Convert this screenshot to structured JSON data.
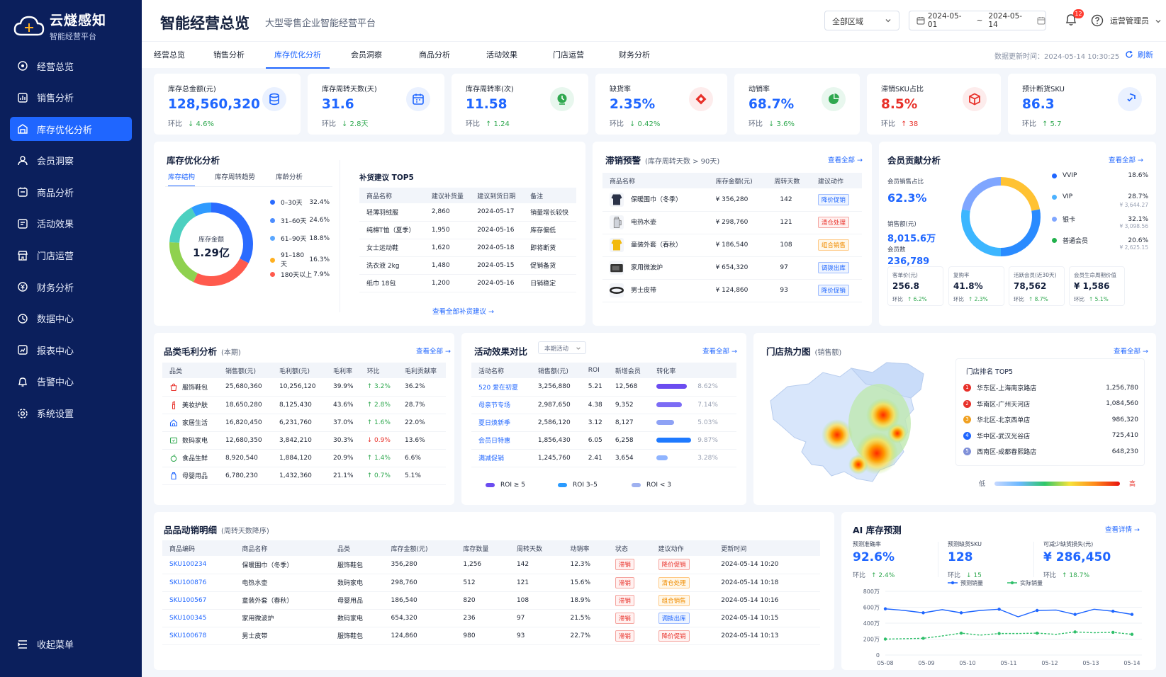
{
  "brand": {
    "name": "云燧感知",
    "tagline": "智能经营平台"
  },
  "sidebar": {
    "items": [
      {
        "label": "经营总览",
        "icon": "overview-icon"
      },
      {
        "label": "销售分析",
        "icon": "sales-icon"
      },
      {
        "label": "库存优化分析",
        "icon": "inventory-icon",
        "active": true
      },
      {
        "label": "会员洞察",
        "icon": "member-icon"
      },
      {
        "label": "商品分析",
        "icon": "product-icon"
      },
      {
        "label": "活动效果",
        "icon": "campaign-icon"
      },
      {
        "label": "门店运营",
        "icon": "store-icon"
      },
      {
        "label": "财务分析",
        "icon": "finance-icon"
      },
      {
        "label": "数据中心",
        "icon": "data-icon"
      },
      {
        "label": "报表中心",
        "icon": "report-icon"
      },
      {
        "label": "告警中心",
        "icon": "alarm-icon"
      },
      {
        "label": "系统设置",
        "icon": "settings-icon"
      }
    ],
    "collapse_label": "收起菜单"
  },
  "header": {
    "title": "智能经营总览",
    "subtitle": "大型零售企业智能经营平台",
    "region": "全部区域",
    "date_start": "2024-05-01",
    "date_sep": "~",
    "date_end": "2024-05-14",
    "notif_count": "12",
    "user": "运营管理员"
  },
  "tabs": {
    "items": [
      "经营总览",
      "销售分析",
      "库存优化分析",
      "会员洞察",
      "商品分析",
      "活动效果",
      "门店运营",
      "财务分析"
    ],
    "active_index": 2,
    "update_time": "数据更新时间：2024-05-14 10:30:25",
    "refresh": "刷新"
  },
  "kpis": [
    {
      "label": "库存总金额(元)",
      "value": "128,560,320",
      "cmp": "环比",
      "delta": "↓ 4.6%",
      "accent": "#1f66ff",
      "bg": "#eaf1ff",
      "icon": "database-icon"
    },
    {
      "label": "库存周转天数(天)",
      "value": "31.6",
      "cmp": "环比",
      "delta": "↓ 2.8天",
      "accent": "#1f66ff",
      "bg": "#eaf1ff",
      "icon": "calendar-icon"
    },
    {
      "label": "库存周转率(次)",
      "value": "11.58",
      "cmp": "环比",
      "delta": "↑ 1.24",
      "accent": "#2fa84f",
      "bg": "#e8f7ee",
      "icon": "turnover-icon"
    },
    {
      "label": "缺货率",
      "value": "2.35%",
      "cmp": "环比",
      "delta": "↓ 0.42%",
      "accent": "#e8312a",
      "bg": "#fdecec",
      "icon": "diamond-icon"
    },
    {
      "label": "动销率",
      "value": "68.7%",
      "cmp": "环比",
      "delta": "↓ 3.6%",
      "accent": "#2fa84f",
      "bg": "#e8f7ee",
      "icon": "pie-icon"
    },
    {
      "label": "滞销SKU占比",
      "value": "8.5%",
      "cmp": "环比",
      "delta": "↑ 38",
      "accent": "#e8312a",
      "bg": "#fdecec",
      "icon": "cube-icon",
      "red": true
    },
    {
      "label": "预计断货SKU",
      "value": "86.3",
      "cmp": "环比",
      "delta": "↑ 5.7",
      "accent": "#1f66ff",
      "bg": "#eaf1ff",
      "icon": "shield-icon"
    }
  ],
  "inventory": {
    "title": "库存优化分析",
    "subtabs": [
      "库存结构",
      "库存周转趋势",
      "库龄分析"
    ],
    "donut_label": "库存金额",
    "donut_value": "1.29亿",
    "segments": [
      {
        "name": "0–30天",
        "pct": "32.4%",
        "value": 32.4,
        "color": "#2a6bff"
      },
      {
        "name": "31–60天",
        "pct": "24.6%",
        "value": 24.6,
        "color": "#ff5a4d"
      },
      {
        "name": "61–90天",
        "pct": "18.8%",
        "value": 18.8,
        "color": "#8fd14f"
      },
      {
        "name": "91–180天",
        "pct": "16.3%",
        "value": 16.3,
        "color": "#4cd0c0"
      },
      {
        "name": "180天以上",
        "pct": "7.9%",
        "value": 7.9,
        "color": "#2f9bff"
      }
    ],
    "legend_colors": [
      "#2a6bff",
      "#4c8dff",
      "#5aa7ff",
      "#ffb020",
      "#ff5a4d"
    ]
  },
  "replenish": {
    "title": "补货建议 TOP5",
    "headers": [
      "商品名称",
      "建议补货量",
      "建议到货日期",
      "备注"
    ],
    "rows": [
      [
        "轻薄羽绒服",
        "2,860",
        "2024-05-17",
        "销量增长较快"
      ],
      [
        "纯棉T恤（夏季）",
        "1,950",
        "2024-05-16",
        "库存偏低"
      ],
      [
        "女士运动鞋",
        "1,620",
        "2024-05-18",
        "即将断货"
      ],
      [
        "洗衣液 2kg",
        "1,480",
        "2024-05-15",
        "促销备货"
      ],
      [
        "纸巾 18包",
        "1,200",
        "2024-05-16",
        "日销稳定"
      ]
    ],
    "link": "查看全部补货建议 →"
  },
  "slow": {
    "title": "滞销预警",
    "subtitle": "(库存周转天数 > 90天)",
    "more": "查看全部 →",
    "headers": [
      "商品名称",
      "库存金额(元)",
      "周转天数",
      "建议动作"
    ],
    "rows": [
      {
        "name": "保暖围巾（冬季）",
        "amount": "¥ 356,280",
        "days": "142",
        "action": "降价促销",
        "tag": "blue"
      },
      {
        "name": "电热水壶",
        "amount": "¥ 298,760",
        "days": "121",
        "action": "清仓处理",
        "tag": "red"
      },
      {
        "name": "童装外套（春秋）",
        "amount": "¥ 186,540",
        "days": "108",
        "action": "组合销售",
        "tag": "orange"
      },
      {
        "name": "家用微波炉",
        "amount": "¥ 654,320",
        "days": "97",
        "action": "调拨出库",
        "tag": "blue"
      },
      {
        "name": "男士皮带",
        "amount": "¥ 124,860",
        "days": "93",
        "action": "降价促销",
        "tag": "blue"
      }
    ]
  },
  "member": {
    "title": "会员贡献分析",
    "more": "查看全部 →",
    "share_label": "会员销售占比",
    "share_value": "62.3%",
    "sales_label": "销售额(元)",
    "sales_value": "8,015.6万",
    "count_label": "会员数",
    "count_value": "236,789",
    "legend": [
      {
        "name": "VVIP",
        "pct": "18.6%",
        "sub": "",
        "color": "#1f66ff",
        "value": 18.6
      },
      {
        "name": "VIP",
        "pct": "28.7%",
        "sub": "¥ 3,644.27",
        "color": "#4cb2ff",
        "value": 28.7
      },
      {
        "name": "银卡",
        "pct": "32.1%",
        "sub": "¥ 3,098.56",
        "color": "#7fa6ff",
        "value": 32.1
      },
      {
        "name": "普通会员",
        "pct": "20.6%",
        "sub": "¥ 2,625.15",
        "color": "#22b14c",
        "value": 20.6
      }
    ],
    "donut_colors": [
      "#ffc233",
      "#2a8bff",
      "#3cb6ff",
      "#7fa6ff"
    ],
    "donut_values": [
      22,
      28,
      28,
      22
    ],
    "stats": [
      {
        "label": "客单价(元)",
        "value": "256.8",
        "cmp": "环比",
        "delta": "↑ 6.2%"
      },
      {
        "label": "复购率",
        "value": "41.8%",
        "cmp": "环比",
        "delta": "↑ 2.3%"
      },
      {
        "label": "活跃会员(近30天)",
        "value": "78,562",
        "cmp": "环比",
        "delta": "↑ 8.7%"
      },
      {
        "label": "会员生命周期价值",
        "value": "¥ 1,586",
        "cmp": "环比",
        "delta": "↑ 5.1%"
      }
    ]
  },
  "margin": {
    "title": "品类毛利分析",
    "subtitle": "(本期)",
    "more": "查看全部 →",
    "headers": [
      "品类",
      "销售额(元)",
      "毛利额(元)",
      "毛利率",
      "环比",
      "毛利贡献率"
    ],
    "rows": [
      {
        "cat": "服饰鞋包",
        "sales": "25,680,360",
        "profit": "10,256,120",
        "rate": "39.9%",
        "delta": "↑ 3.2%",
        "dir": "up",
        "share": "36.2%",
        "icon": "bag-icon",
        "color": "#e8312a"
      },
      {
        "cat": "美妆护肤",
        "sales": "18,650,280",
        "profit": "8,125,430",
        "rate": "43.6%",
        "delta": "↑ 2.8%",
        "dir": "up",
        "share": "28.7%",
        "icon": "lipstick-icon",
        "color": "#e8312a"
      },
      {
        "cat": "家居生活",
        "sales": "16,820,450",
        "profit": "6,231,760",
        "rate": "37.0%",
        "delta": "↑ 1.6%",
        "dir": "up",
        "share": "22.0%",
        "icon": "home-icon",
        "color": "#1f66ff"
      },
      {
        "cat": "数码家电",
        "sales": "12,680,350",
        "profit": "3,842,210",
        "rate": "30.3%",
        "delta": "↓ 0.9%",
        "dir": "down",
        "share": "13.6%",
        "icon": "device-icon",
        "color": "#2fa84f"
      },
      {
        "cat": "食品生鲜",
        "sales": "8,920,540",
        "profit": "1,884,120",
        "rate": "20.9%",
        "delta": "↑ 1.4%",
        "dir": "up",
        "share": "6.6%",
        "icon": "food-icon",
        "color": "#2fa84f"
      },
      {
        "cat": "母婴用品",
        "sales": "6,780,230",
        "profit": "1,432,360",
        "rate": "21.1%",
        "delta": "↑ 0.7%",
        "dir": "up",
        "share": "5.1%",
        "icon": "baby-icon",
        "color": "#1f66ff"
      }
    ]
  },
  "campaign": {
    "title": "活动效果对比",
    "filter": "本期活动",
    "more": "查看全部 →",
    "headers": [
      "活动名称",
      "销售额(元)",
      "ROI",
      "新增会员",
      "转化率"
    ],
    "rows": [
      {
        "name": "520 爱在初夏",
        "sales": "3,256,880",
        "roi": "5.21",
        "members": "12,568",
        "conv": "8.62%",
        "value": 8.62,
        "color": "#6b4cf0"
      },
      {
        "name": "母亲节专场",
        "sales": "2,987,650",
        "roi": "4.38",
        "members": "9,352",
        "conv": "7.14%",
        "value": 7.14,
        "color": "#7c6cf5"
      },
      {
        "name": "夏日焕新季",
        "sales": "2,586,120",
        "roi": "3.12",
        "members": "8,127",
        "conv": "5.03%",
        "value": 5.03,
        "color": "#8ea2f5"
      },
      {
        "name": "会员日特惠",
        "sales": "1,856,430",
        "roi": "6.05",
        "members": "6,258",
        "conv": "9.87%",
        "value": 9.87,
        "color": "#1f7aff"
      },
      {
        "name": "满减促销",
        "sales": "1,245,760",
        "roi": "2.41",
        "members": "3,654",
        "conv": "3.28%",
        "value": 3.28,
        "color": "#8fb4ff"
      }
    ],
    "legend": [
      {
        "name": "ROI ≥ 5",
        "color": "#6b4cf0"
      },
      {
        "name": "ROI 3–5",
        "color": "#2a9bff"
      },
      {
        "name": "ROI < 3",
        "color": "#9fb1f0"
      }
    ]
  },
  "heatmap": {
    "title": "门店热力图",
    "subtitle": "(销售额)",
    "more": "查看全部 →",
    "rank_title": "门店排名 TOP5",
    "ranks": [
      {
        "n": "1",
        "name": "华东区-上海南京路店",
        "value": "1,256,780",
        "color": "#e8312a"
      },
      {
        "n": "2",
        "name": "华南区-广州天河店",
        "value": "1,084,560",
        "color": "#e8312a"
      },
      {
        "n": "3",
        "name": "华北区-北京西单店",
        "value": "986,320",
        "color": "#f0a020"
      },
      {
        "n": "4",
        "name": "华中区-武汉光谷店",
        "value": "725,410",
        "color": "#1f66ff"
      },
      {
        "n": "5",
        "name": "西南区-成都春熙路店",
        "value": "648,230",
        "color": "#7f8fd8"
      }
    ],
    "scale_low": "低",
    "scale_high": "高"
  },
  "detail": {
    "title": "品品动销明细",
    "subtitle": "(周转天数降序)",
    "headers": [
      "商品编码",
      "商品名称",
      "品类",
      "库存金额(元)",
      "库存数量",
      "周转天数",
      "动销率",
      "状态",
      "建议动作",
      "更新时间"
    ],
    "rows": [
      {
        "code": "SKU100234",
        "name": "保暖围巾（冬季）",
        "cat": "服饰鞋包",
        "amount": "356,280",
        "qty": "1,256",
        "days": "142",
        "rate": "12.3%",
        "status": "滞销",
        "action": "降价促销",
        "tag": "red",
        "time": "2024-05-14 10:20"
      },
      {
        "code": "SKU100876",
        "name": "电热水壶",
        "cat": "数码家电",
        "amount": "298,760",
        "qty": "512",
        "days": "121",
        "rate": "15.6%",
        "status": "滞销",
        "action": "清仓处理",
        "tag": "orange",
        "time": "2024-05-14 10:18"
      },
      {
        "code": "SKU100567",
        "name": "童装外套（春秋）",
        "cat": "母婴用品",
        "amount": "186,540",
        "qty": "820",
        "days": "108",
        "rate": "18.9%",
        "status": "滞销",
        "action": "组合销售",
        "tag": "orange",
        "time": "2024-05-14 10:16"
      },
      {
        "code": "SKU100345",
        "name": "家用微波炉",
        "cat": "数码家电",
        "amount": "654,320",
        "qty": "236",
        "days": "97",
        "rate": "21.5%",
        "status": "滞销",
        "action": "调拨出库",
        "tag": "blue",
        "time": "2024-05-14 10:15"
      },
      {
        "code": "SKU100678",
        "name": "男士皮带",
        "cat": "服饰鞋包",
        "amount": "124,860",
        "qty": "980",
        "days": "93",
        "rate": "22.7%",
        "status": "滞销",
        "action": "降价促销",
        "tag": "red",
        "time": "2024-05-14 10:13"
      }
    ]
  },
  "ai": {
    "title": "AI 库存预测",
    "more": "查看详情 →",
    "stats": [
      {
        "label": "预测准确率",
        "value": "92.6%",
        "cmp": "环比",
        "delta": "↑ 2.4%"
      },
      {
        "label": "预测缺货SKU",
        "value": "128",
        "cmp": "环比",
        "delta": "↓ 15"
      },
      {
        "label": "可减少缺货损失(元)",
        "value": "¥ 286,450",
        "cmp": "环比",
        "delta": "↑ 18.7%"
      }
    ]
  },
  "chart_data": {
    "type": "line",
    "title": "",
    "x": [
      "05-08",
      "05-09",
      "05-10",
      "05-11",
      "05-12",
      "05-13",
      "05-14"
    ],
    "y_ticks": [
      "800万",
      "600万",
      "400万",
      "200万",
      "0"
    ],
    "ylim": [
      0,
      800
    ],
    "series": [
      {
        "name": "预测销量",
        "color": "#1f66ff",
        "values": [
          580,
          560,
          530,
          570,
          530,
          560,
          575,
          480,
          560,
          565,
          510,
          575,
          550,
          510
        ]
      },
      {
        "name": "实际销量",
        "color": "#2fbf6a",
        "values": [
          200,
          205,
          210,
          240,
          275,
          250,
          270,
          270,
          275,
          260,
          290,
          280,
          285,
          260
        ]
      }
    ],
    "legend_position": "top"
  }
}
